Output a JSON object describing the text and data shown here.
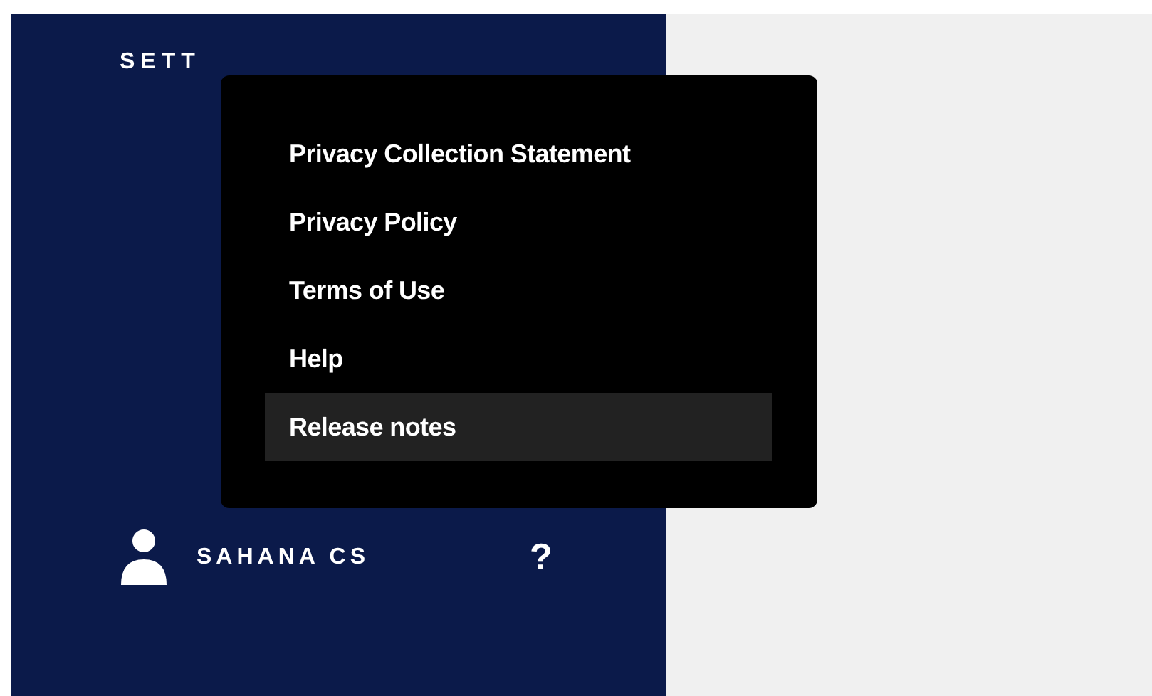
{
  "sidebar": {
    "heading": "SETT",
    "user": {
      "name": "SAHANA CS"
    },
    "help": "?"
  },
  "menu": {
    "items": [
      {
        "label": "Privacy Collection Statement",
        "selected": false
      },
      {
        "label": "Privacy Policy",
        "selected": false
      },
      {
        "label": "Terms of Use",
        "selected": false
      },
      {
        "label": "Help",
        "selected": false
      },
      {
        "label": "Release notes",
        "selected": true
      }
    ]
  }
}
